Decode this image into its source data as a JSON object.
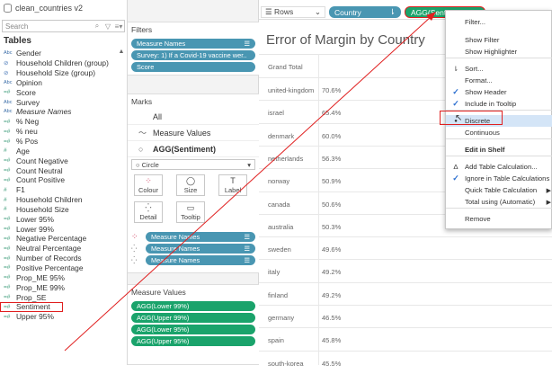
{
  "datasource": {
    "title": "clean_countries v2",
    "search_placeholder": "Search"
  },
  "tables_heading": "Tables",
  "fields": [
    {
      "type": "Abc",
      "name": "Gender"
    },
    {
      "type": "⊘",
      "name": "Household Children (group)"
    },
    {
      "type": "⊘",
      "name": "Household Size (group)"
    },
    {
      "type": "Abc",
      "name": "Opinion"
    },
    {
      "type": "=#",
      "name": "Score"
    },
    {
      "type": "Abc",
      "name": "Survey"
    },
    {
      "type": "Abc",
      "name": "Measure Names"
    },
    {
      "type": "=#",
      "name": "% Neg"
    },
    {
      "type": "=#",
      "name": "% neu"
    },
    {
      "type": "=#",
      "name": "% Pos"
    },
    {
      "type": "#",
      "name": "Age"
    },
    {
      "type": "=#",
      "name": "Count Negative"
    },
    {
      "type": "=#",
      "name": "Count Neutral"
    },
    {
      "type": "=#",
      "name": "Count Positive"
    },
    {
      "type": "#",
      "name": "F1"
    },
    {
      "type": "#",
      "name": "Household Children"
    },
    {
      "type": "#",
      "name": "Household Size"
    },
    {
      "type": "=#",
      "name": "Lower 95%"
    },
    {
      "type": "=#",
      "name": "Lower 99%"
    },
    {
      "type": "=#",
      "name": "Negative Percentage"
    },
    {
      "type": "=#",
      "name": "Neutral Percentage"
    },
    {
      "type": "=#",
      "name": "Number of Records"
    },
    {
      "type": "=#",
      "name": "Positive Percentage"
    },
    {
      "type": "=#",
      "name": "Prop_ME 95%"
    },
    {
      "type": "=#",
      "name": "Prop_ME 99%"
    },
    {
      "type": "=#",
      "name": "Prop_SE"
    },
    {
      "type": "=#",
      "name": "Sentiment"
    },
    {
      "type": "=#",
      "name": "Upper 95%"
    }
  ],
  "filters": {
    "heading": "Filters",
    "pills": [
      "Measure Names",
      "Survey: 1) If a Covid-19 vaccine wer..",
      "Score"
    ]
  },
  "marks": {
    "heading": "Marks",
    "rows": [
      {
        "icon": "",
        "label": "All"
      },
      {
        "icon": "~",
        "label": "Measure Values"
      },
      {
        "icon": "○",
        "label": "AGG(Sentiment)"
      }
    ],
    "mark_type": "Circle",
    "buttons": [
      {
        "glyph": "⁘",
        "label": "Colour"
      },
      {
        "glyph": "◯",
        "label": "Size"
      },
      {
        "glyph": "T",
        "label": "Label"
      },
      {
        "glyph": "⁛",
        "label": "Detail"
      },
      {
        "glyph": "▭",
        "label": "Tooltip"
      }
    ],
    "pills": [
      "Measure Names",
      "Measure Names",
      "Measure Names"
    ]
  },
  "measure_values": {
    "heading": "Measure Values",
    "pills": [
      "AGG(Lower 99%)",
      "AGG(Upper 99%)",
      "AGG(Lower 95%)",
      "AGG(Upper 95%)"
    ]
  },
  "shelf": {
    "rows_label": "Rows",
    "country_pill": "Country",
    "agg_pill": "AGG(Sentiment)"
  },
  "view": {
    "title": "Error of Margin by Country",
    "grand_total": "Grand Total",
    "rows": [
      {
        "country": "united-kingdom",
        "value": "70.6%"
      },
      {
        "country": "israel",
        "value": "65.4%"
      },
      {
        "country": "denmark",
        "value": "60.0%"
      },
      {
        "country": "netherlands",
        "value": "56.3%"
      },
      {
        "country": "norway",
        "value": "50.9%"
      },
      {
        "country": "canada",
        "value": "50.6%"
      },
      {
        "country": "australia",
        "value": "50.3%"
      },
      {
        "country": "sweden",
        "value": "49.6%"
      },
      {
        "country": "italy",
        "value": "49.2%"
      },
      {
        "country": "finland",
        "value": "49.2%"
      },
      {
        "country": "germany",
        "value": "46.5%"
      },
      {
        "country": "spain",
        "value": "45.8%"
      },
      {
        "country": "south-korea",
        "value": "45.5%"
      }
    ]
  },
  "context_menu": {
    "items": [
      {
        "label": "Filter...",
        "prefix": ""
      },
      {
        "label": "Show Filter",
        "prefix": ""
      },
      {
        "label": "Show Highlighter",
        "prefix": ""
      },
      {
        "label": "Sort...",
        "prefix": "sort"
      },
      {
        "label": "Format...",
        "prefix": ""
      },
      {
        "label": "Show Header",
        "prefix": "check"
      },
      {
        "label": "Include in Tooltip",
        "prefix": "check"
      },
      {
        "label": "Discrete",
        "prefix": "dot"
      },
      {
        "label": "Continuous",
        "prefix": ""
      },
      {
        "label": "Edit in Shelf",
        "prefix": ""
      },
      {
        "label": "Add Table Calculation...",
        "prefix": "delta"
      },
      {
        "label": "Ignore in Table Calculations",
        "prefix": "check"
      },
      {
        "label": "Quick Table Calculation",
        "prefix": "",
        "submenu": true
      },
      {
        "label": "Total using (Automatic)",
        "prefix": "",
        "submenu": true
      },
      {
        "label": "Remove",
        "prefix": ""
      }
    ]
  },
  "colors": {
    "pill_blue": "#4996b2",
    "pill_green": "#1aa36b",
    "highlight_red": "#e02020",
    "menu_highlight": "#d4e5f7"
  }
}
